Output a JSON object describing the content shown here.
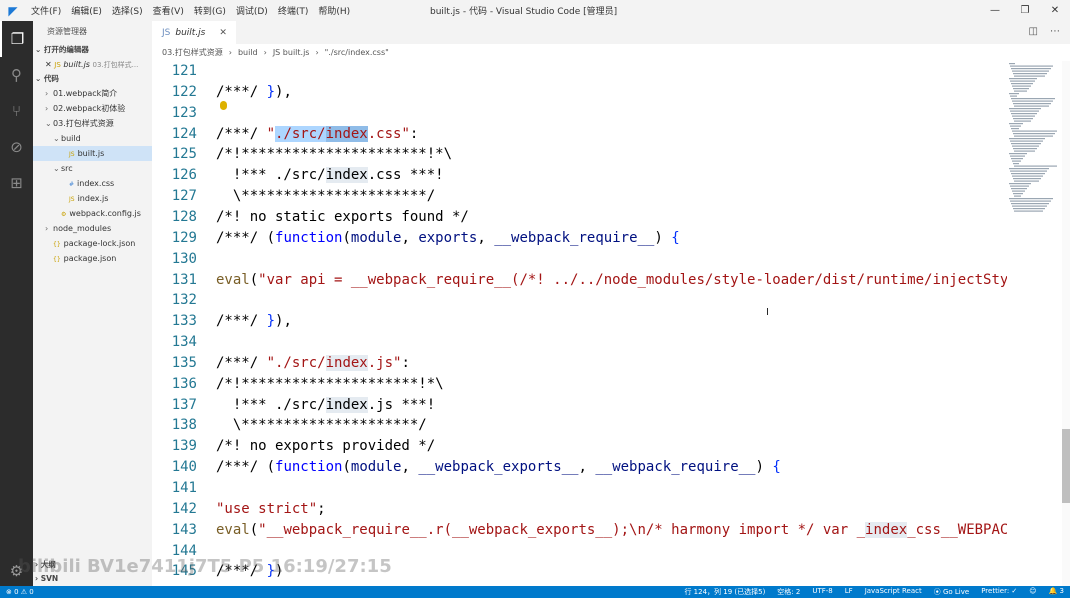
{
  "titlebar": {
    "menu": [
      "文件(F)",
      "编辑(E)",
      "选择(S)",
      "查看(V)",
      "转到(G)",
      "调试(D)",
      "终端(T)",
      "帮助(H)"
    ],
    "window_title": "built.js - 代码 - Visual Studio Code [管理员]",
    "controls": [
      "—",
      "❐",
      "✕"
    ]
  },
  "activity_bar": {
    "icons": [
      "files-icon",
      "search-icon",
      "source-control-icon",
      "debug-icon",
      "extensions-icon"
    ],
    "gear": "⚙"
  },
  "sidebar": {
    "title": "资源管理器",
    "open_editors_header": "打开的编辑器",
    "open_editors": [
      {
        "close": "✕",
        "name": "built.js",
        "path": "03.打包样式..."
      }
    ],
    "folder_header": "代码",
    "tree": [
      {
        "twisty": "›",
        "icon": "",
        "label": "01.webpack简介",
        "level": 1
      },
      {
        "twisty": "›",
        "icon": "",
        "label": "02.webpack初体验",
        "level": 1
      },
      {
        "twisty": "⌄",
        "icon": "",
        "label": "03.打包样式资源",
        "level": 1
      },
      {
        "twisty": "⌄",
        "icon": "",
        "label": "build",
        "level": 2
      },
      {
        "twisty": "",
        "icon": "JS",
        "label": "built.js",
        "level": 3,
        "selected": true
      },
      {
        "twisty": "⌄",
        "icon": "",
        "label": "src",
        "level": 2
      },
      {
        "twisty": "",
        "icon": "#",
        "label": "index.css",
        "level": 3
      },
      {
        "twisty": "",
        "icon": "JS",
        "label": "index.js",
        "level": 3
      },
      {
        "twisty": "",
        "icon": "⚙",
        "label": "webpack.config.js",
        "level": 2
      },
      {
        "twisty": "›",
        "icon": "",
        "label": "node_modules",
        "level": 1
      },
      {
        "twisty": "",
        "icon": "{}",
        "label": "package-lock.json",
        "level": 1
      },
      {
        "twisty": "",
        "icon": "{}",
        "label": "package.json",
        "level": 1
      }
    ],
    "bottom_sections": [
      "大纲",
      "SVN"
    ]
  },
  "tab": {
    "label": "built.js",
    "close": "✕"
  },
  "breadcrumb": [
    "03.打包样式资源",
    "›",
    "build",
    "›",
    "JS built.js",
    "›",
    "\"./src/index.css\""
  ],
  "editor": {
    "lines": [
      {
        "n": "121",
        "html": ""
      },
      {
        "n": "122",
        "html": "/***/ <span class=\"c-br1\">}</span>),"
      },
      {
        "n": "123",
        "html": ""
      },
      {
        "n": "124",
        "html": "/***/ <span class=\"c-str\">\"<span class=\"hl\">./src/<span class=\"hl\" style=\"background:#8fbce8\">index</span></span>.css\"</span>:"
      },
      {
        "n": "125",
        "html": "/*!**********************!*\\"
      },
      {
        "n": "126",
        "html": "  !*** ./src/<span class=\"hl2\">index</span>.css ***!"
      },
      {
        "n": "127",
        "html": "  \\**********************/"
      },
      {
        "n": "128",
        "html": "/*! no static exports found */"
      },
      {
        "n": "129",
        "html": "/***/ (<span class=\"c-kw\">function</span>(<span class=\"c-vb\">module</span>, <span class=\"c-vb\">exports</span>, <span class=\"c-vb\">__webpack_require__</span>) <span class=\"c-br1\">{</span>"
      },
      {
        "n": "130",
        "html": ""
      },
      {
        "n": "131",
        "html": "<span class=\"c-par\">eval</span>(<span class=\"c-str\">\"var api = __webpack_require__(/*! ../../node_modules/style-loader/dist/runtime/injectSty</span>"
      },
      {
        "n": "132",
        "html": ""
      },
      {
        "n": "133",
        "html": "/***/ <span class=\"c-br1\">}</span>),"
      },
      {
        "n": "134",
        "html": ""
      },
      {
        "n": "135",
        "html": "/***/ <span class=\"c-str\">\"./src/<span class=\"hl2\">index</span>.js\"</span>:"
      },
      {
        "n": "136",
        "html": "/*!*********************!*\\"
      },
      {
        "n": "137",
        "html": "  !*** ./src/<span class=\"hl2\">index</span>.js ***!"
      },
      {
        "n": "138",
        "html": "  \\*********************/"
      },
      {
        "n": "139",
        "html": "/*! no exports provided */"
      },
      {
        "n": "140",
        "html": "/***/ (<span class=\"c-kw\">function</span>(<span class=\"c-vb\">module</span>, <span class=\"c-vb\">__webpack_exports__</span>, <span class=\"c-vb\">__webpack_require__</span>) <span class=\"c-br1\">{</span>"
      },
      {
        "n": "141",
        "html": ""
      },
      {
        "n": "142",
        "html": "<span class=\"c-str\">\"use strict\"</span>;"
      },
      {
        "n": "143",
        "html": "<span class=\"c-par\">eval</span>(<span class=\"c-str\">\"__webpack_require__.r(__webpack_exports__);\\n/* harmony import */ var _<span class=\"hl2\">index</span>_css__WEBPAC</span>"
      },
      {
        "n": "144",
        "html": ""
      },
      {
        "n": "145",
        "html": "/***/ <span class=\"c-br1\">}</span>)"
      }
    ]
  },
  "statusbar": {
    "left": [
      "⊗ 0 ⚠ 0"
    ],
    "right": [
      "行 124，列 19 (已选择5)",
      "空格: 2",
      "UTF-8",
      "LF",
      "JavaScript React",
      "⦿ Go Live",
      "Prettier: ✓",
      "☺",
      "🔔 3"
    ]
  },
  "watermark": "bilibili BV1e7411j7T5 P5 16:19/27:15"
}
